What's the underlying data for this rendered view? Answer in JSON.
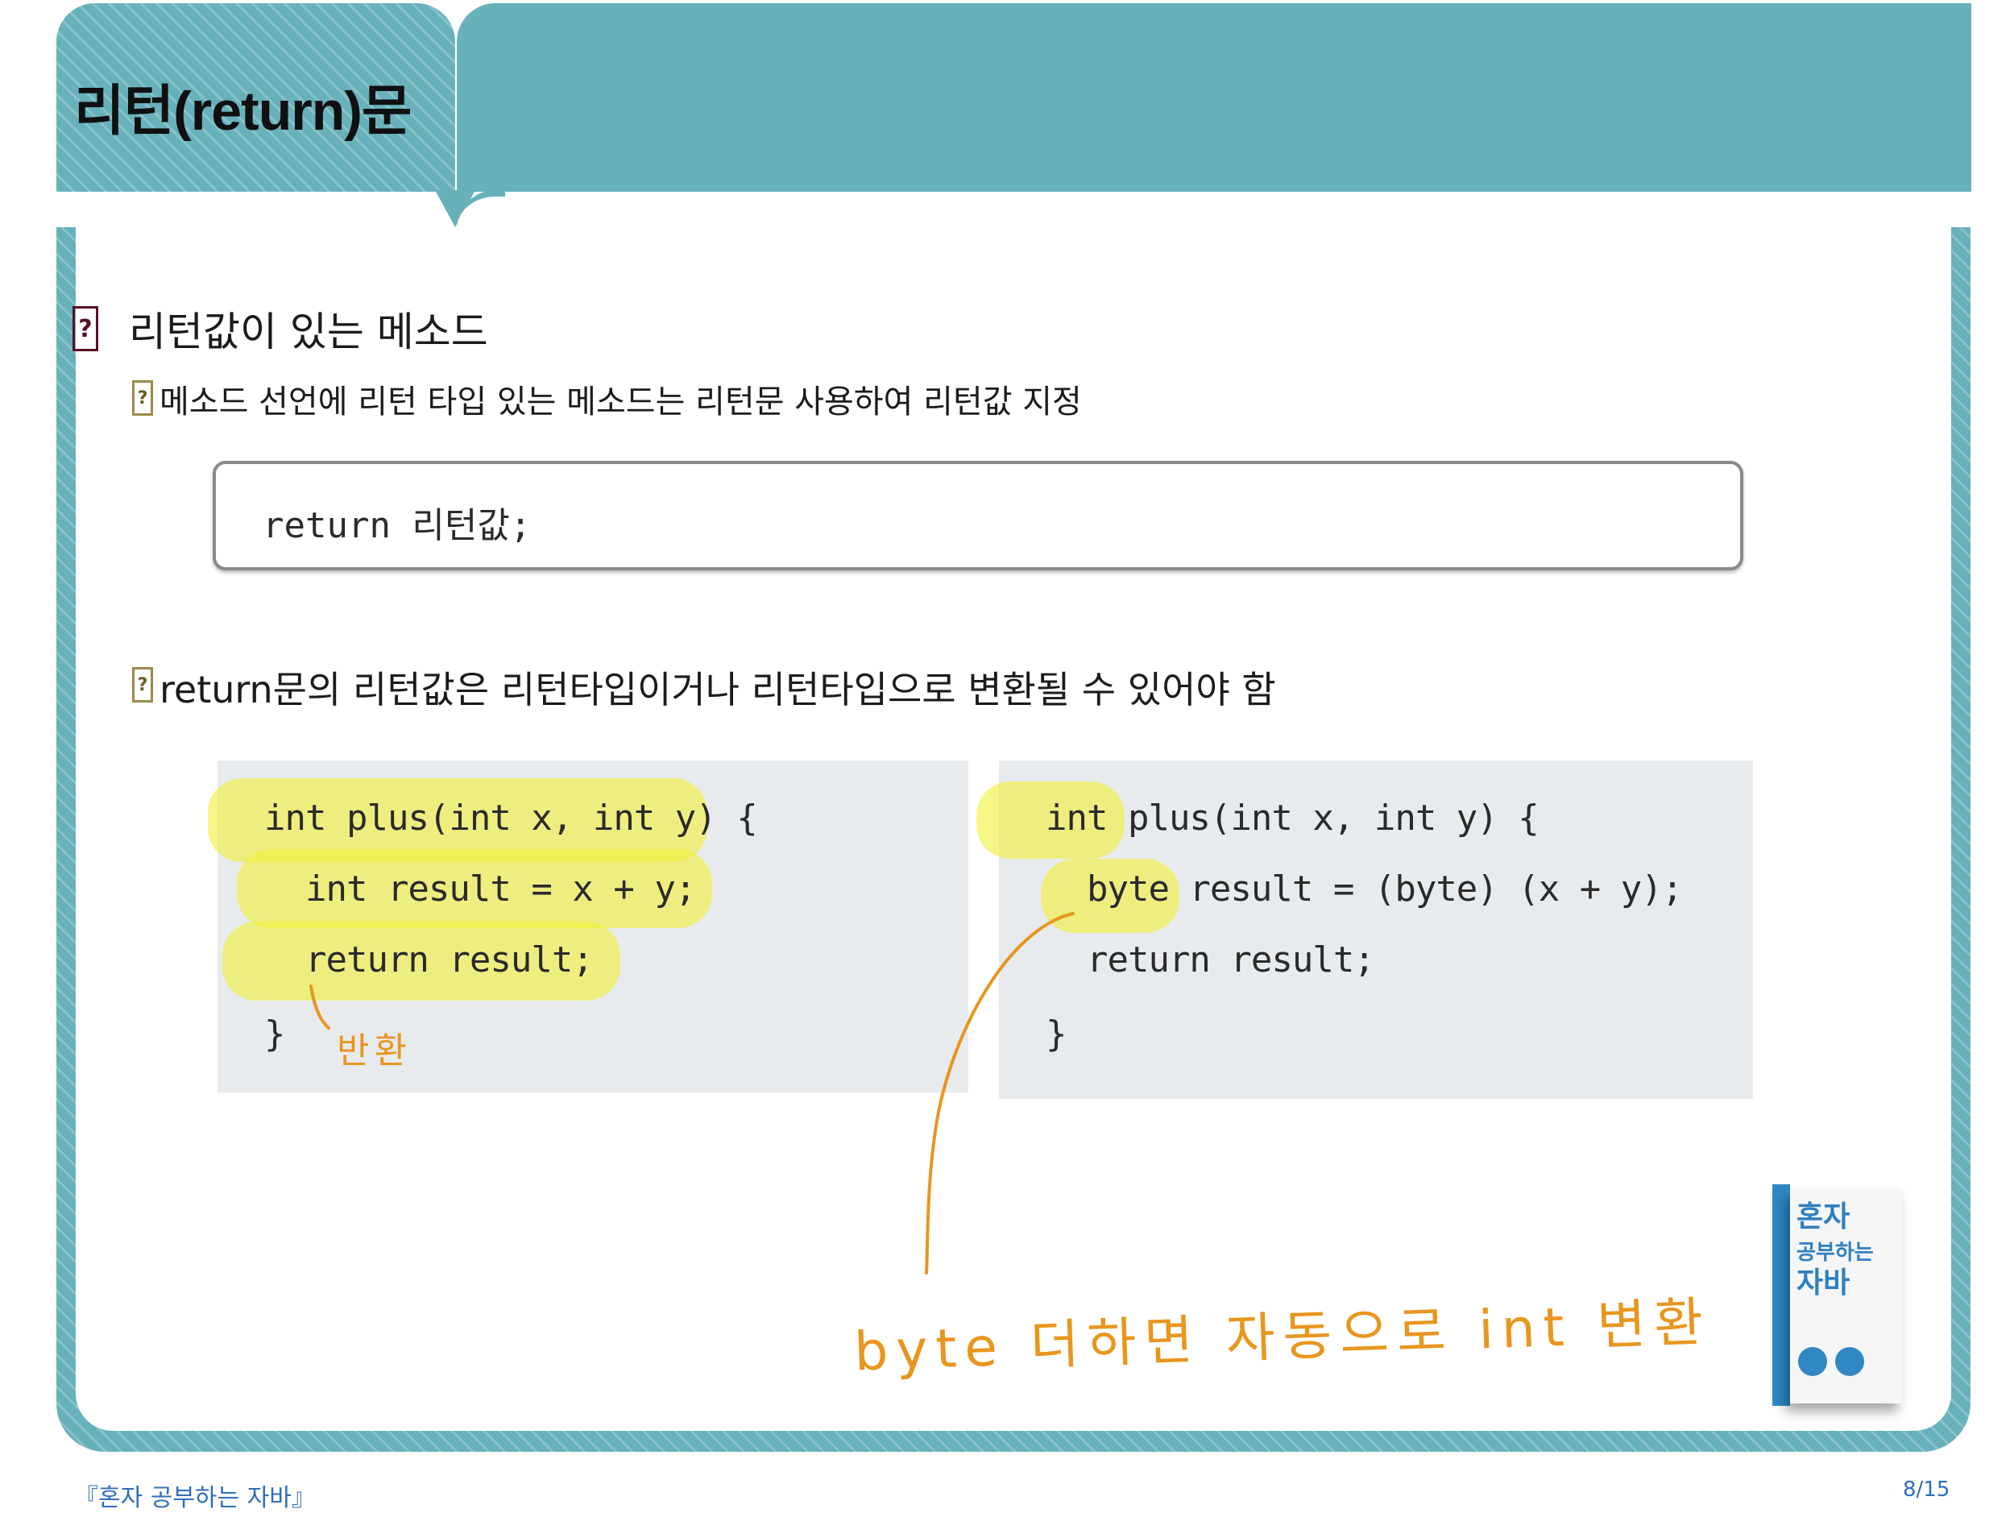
{
  "slide": {
    "title": "리턴(return)문",
    "heading": "리턴값이 있는 메소드",
    "bullet_1": "메소드 선언에 리턴 타입 있는 메소드는 리턴문 사용하여 리턴값 지정",
    "syntax": "return 리턴값;",
    "bullet_2": "return문의 리턴값은 리턴타입이거나 리턴타입으로 변환될 수 있어야 함",
    "question_marker": "?"
  },
  "code_left": [
    "int plus(int x, int y) {",
    "  int result = x + y;",
    "  return result;",
    "}"
  ],
  "code_right": [
    "int plus(int x, int y) {",
    "  byte result = (byte) (x + y);",
    "  return result;",
    "}"
  ],
  "annotations": {
    "left_note": "반환",
    "bottom_note": "byte 더하면 자동으로 int 변환"
  },
  "book": {
    "title_line_1": "혼자",
    "title_line_2": "공부하는",
    "title_line_3": "자바"
  },
  "footer": {
    "book_name": "『혼자 공부하는 자바』",
    "page": "8/15"
  },
  "colors": {
    "header_teal": "#67b1bb",
    "highlight_yellow": "#f0f03c",
    "ink_orange": "#e8961e",
    "footer_blue": "#2d6fb8"
  }
}
